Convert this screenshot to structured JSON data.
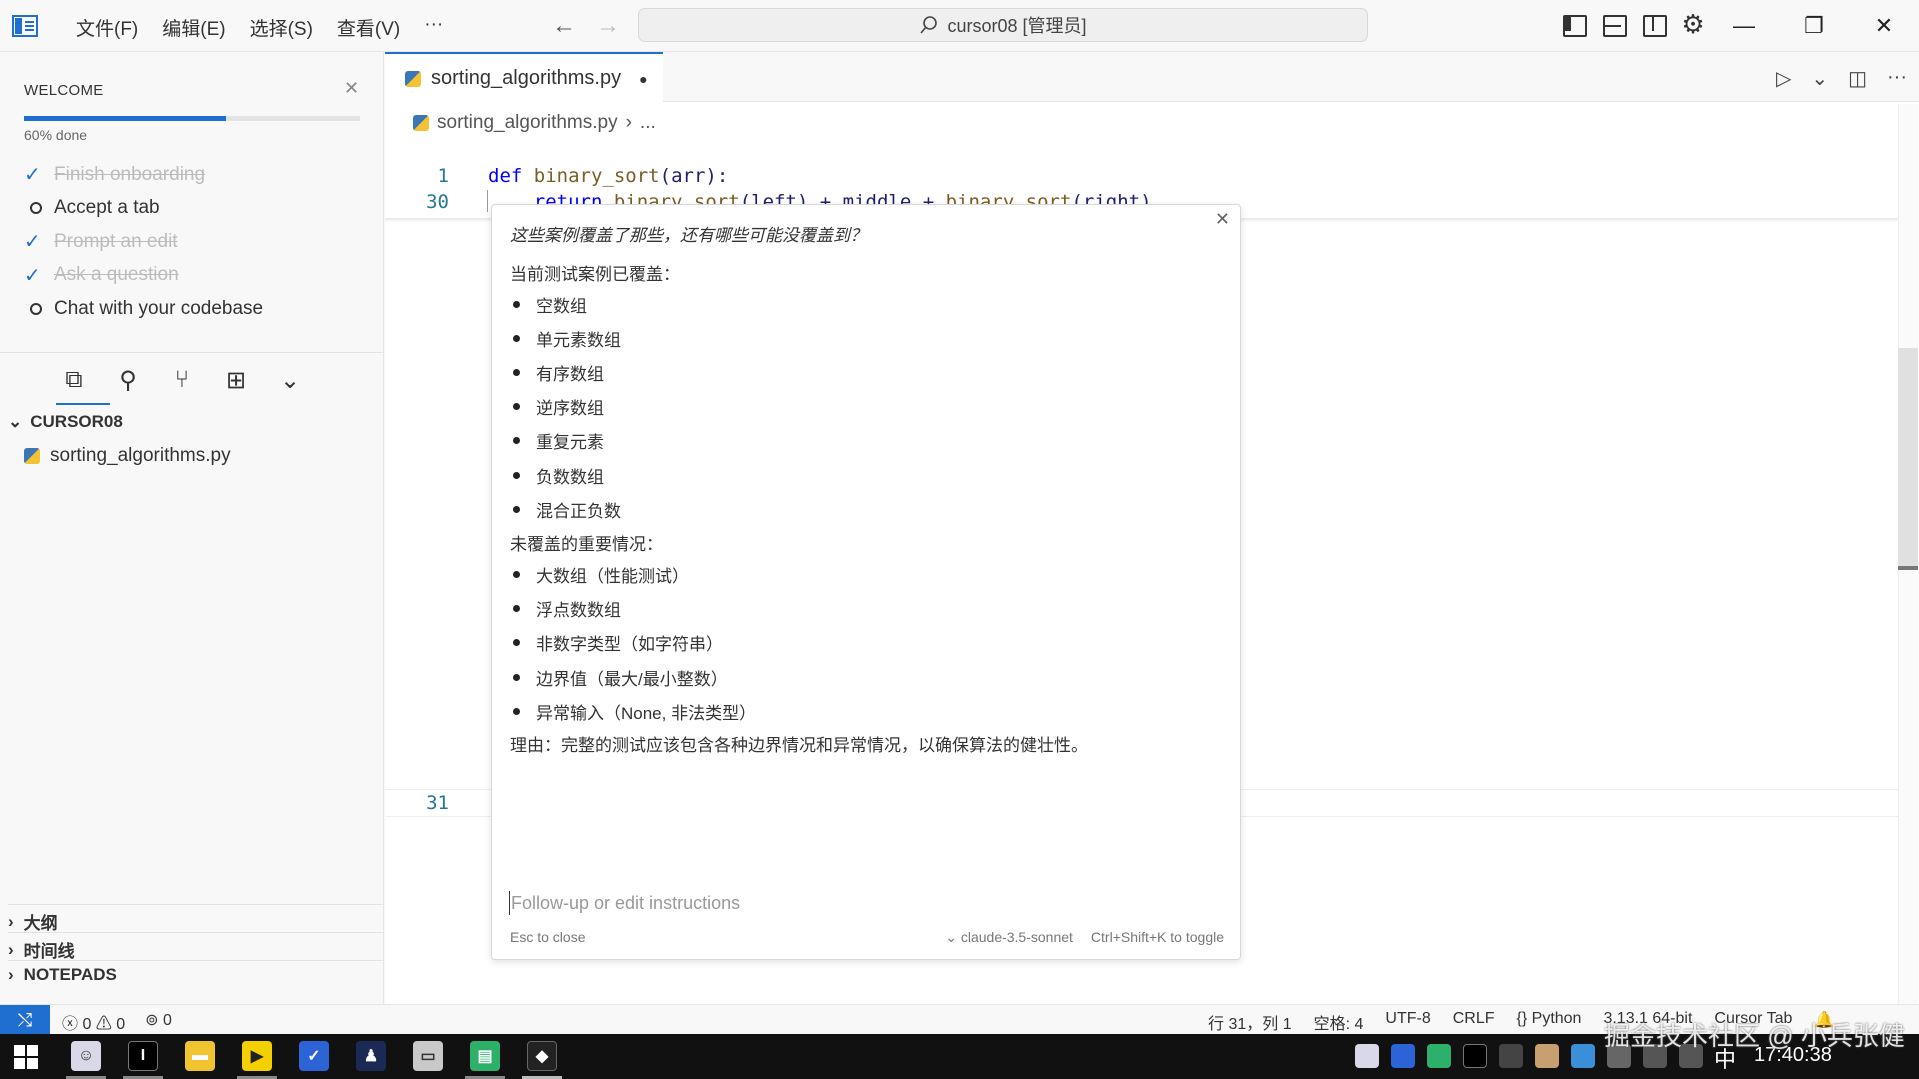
{
  "titlebar": {
    "menu": [
      "文件(F)",
      "编辑(E)",
      "选择(S)",
      "查看(V)",
      "···"
    ],
    "search_text": "cursor08 [管理员]"
  },
  "sidebar": {
    "welcome_title": "WELCOME",
    "progress_percent": 60,
    "progress_label": "60% done",
    "checklist": [
      {
        "label": "Finish onboarding",
        "done": true
      },
      {
        "label": "Accept a tab",
        "done": false
      },
      {
        "label": "Prompt an edit",
        "done": true
      },
      {
        "label": "Ask a question",
        "done": true
      },
      {
        "label": "Chat with your codebase",
        "done": false
      }
    ],
    "folder_name": "CURSOR08",
    "file_name": "sorting_algorithms.py",
    "sections": [
      "大纲",
      "时间线",
      "NOTEPADS"
    ]
  },
  "editor": {
    "tab_label": "sorting_algorithms.py",
    "breadcrumb_file": "sorting_algorithms.py",
    "breadcrumb_more": "...",
    "lines": [
      {
        "num": "1",
        "text": "def binary_sort(arr):"
      },
      {
        "num": "30",
        "text": "    return binary_sort(left) + middle + binary_sort(right)"
      },
      {
        "num": "31",
        "text": ""
      }
    ]
  },
  "popup": {
    "question": "这些案例覆盖了那些，还有哪些可能没覆盖到？",
    "covered_heading": "当前测试案例已覆盖：",
    "covered": [
      "空数组",
      "单元素数组",
      "有序数组",
      "逆序数组",
      "重复元素",
      "负数数组",
      "混合正负数"
    ],
    "uncovered_heading": "未覆盖的重要情况：",
    "uncovered": [
      "大数组（性能测试）",
      "浮点数数组",
      "非数字类型（如字符串）",
      "边界值（最大/最小整数）",
      "异常输入（None, 非法类型）"
    ],
    "reason": "理由：完整的测试应该包含各种边界情况和异常情况，以确保算法的健壮性。",
    "input_placeholder": "Follow-up or edit instructions",
    "esc_hint": "Esc to close",
    "model": "claude-3.5-sonnet",
    "toggle_hint": "Ctrl+Shift+K to toggle"
  },
  "statusbar": {
    "errors": "0",
    "warnings": "0",
    "ports": "0",
    "position": "行 31，列 1",
    "spaces": "空格: 4",
    "encoding": "UTF-8",
    "eol": "CRLF",
    "language": "Python",
    "interpreter": "3.13.1 64-bit",
    "cursor_tab": "Cursor Tab"
  },
  "taskbar": {
    "ime": "中",
    "time": "17:40:38",
    "watermark": "掘金技术社区 @ 小兵张健"
  },
  "colors": {
    "accent": "#1f6fd1",
    "keyword": "#0000ff",
    "line_number": "#237893"
  }
}
